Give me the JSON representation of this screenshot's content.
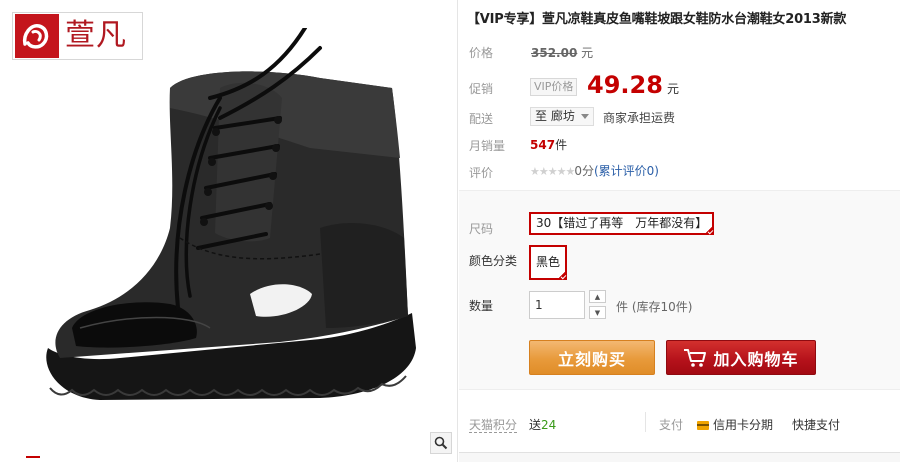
{
  "brand": {
    "name": "萱凡"
  },
  "product": {
    "title": "【VIP专享】萱凡凉鞋真皮鱼嘴鞋坡跟女鞋防水台潮鞋女2013新款"
  },
  "price": {
    "label": "价格",
    "value": "352.00",
    "unit": "元"
  },
  "promo": {
    "label": "促销",
    "tag": "VIP价格",
    "value": "49.28",
    "unit": "元"
  },
  "delivery": {
    "label": "配送",
    "to": "至 廊坊",
    "note": "商家承担运费"
  },
  "sales": {
    "label": "月销量",
    "count": "547",
    "unit": "件"
  },
  "rating": {
    "label": "评价",
    "stars": "★★★★★",
    "score": "0分",
    "link": "(累计评价0)"
  },
  "sku": {
    "size_label": "尺码",
    "size_value": "30【错过了再等　万年都没有】",
    "color_label": "颜色分类",
    "color_value": "黑色",
    "qty_label": "数量",
    "qty_value": "1",
    "qty_unit": "件",
    "stock": "(库存10件)"
  },
  "actions": {
    "buy": "立刻购买",
    "cart": "加入购物车"
  },
  "services": {
    "points_label": "天猫积分",
    "points_prefix": "送",
    "points_value": "24",
    "pay_label": "支付",
    "credit": "信用卡分期",
    "quick": "快捷支付"
  },
  "colors": {
    "accent": "#c40000",
    "buy": "#e8993b",
    "cart": "#b4111a"
  },
  "icons": [
    "zoom-icon",
    "cart-icon",
    "credit-card-icon",
    "chevron-up-icon",
    "chevron-down-icon",
    "caret-down-icon"
  ]
}
